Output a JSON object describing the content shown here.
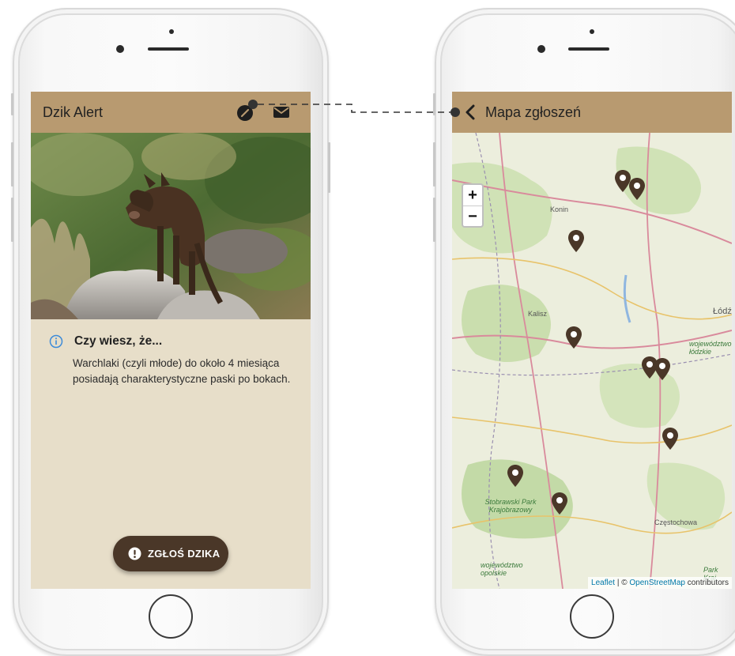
{
  "left_screen": {
    "title": "Dzik Alert",
    "icons": [
      "map-marker-icon",
      "mail-icon"
    ],
    "fact": {
      "title": "Czy wiesz, że...",
      "body": "Warchlaki (czyli młode) do około 4 miesiąca posiadają charakterystyczne paski po bokach."
    },
    "report_button": "ZGŁOŚ DZIKA"
  },
  "right_screen": {
    "title": "Mapa zgłoszeń",
    "zoom_in": "+",
    "zoom_out": "−",
    "map_labels": {
      "konin": "Konin",
      "kalisz": "Kalisz",
      "lodz": "Łódź",
      "wojewodztwo_lodzkie": "województwo łódzkie",
      "stobrawski": "Stobrawski Park Krajobrazowy",
      "czestochowa": "Częstochowa",
      "wojewodztwo_opolskie": "województwo opolskie",
      "park_kraj": "Park Kraj"
    },
    "attribution": {
      "leaflet": "Leaflet",
      "separator": " | © ",
      "osm": "OpenStreetMap",
      "contributors": " contributors"
    }
  },
  "colors": {
    "appbar": "#b89a70",
    "screen_bg": "#e7dec9",
    "fab": "#4a3728",
    "marker": "#4a3728",
    "info_icon": "#3d8bd9",
    "leaflet_link": "#0078a8",
    "connector": "#333333"
  }
}
